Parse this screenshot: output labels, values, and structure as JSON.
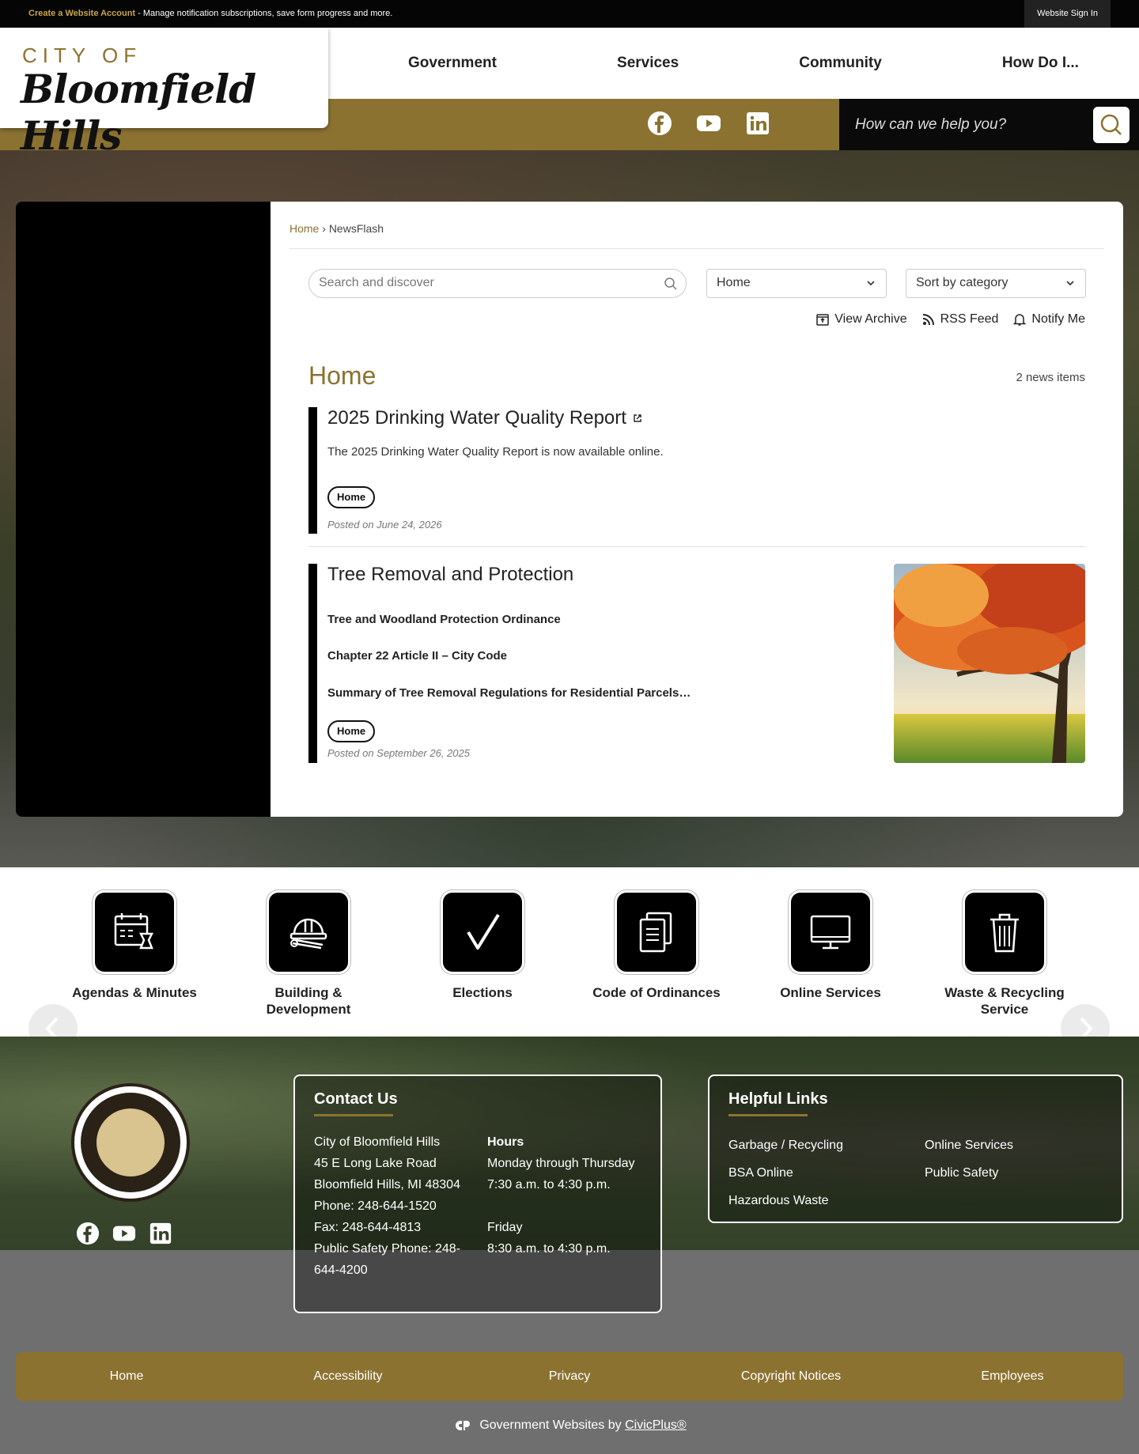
{
  "topbar": {
    "create_link": "Create a Website Account",
    "create_desc": " - Manage notification subscriptions, save form progress and more.",
    "sign_in": "Website Sign In"
  },
  "header": {
    "logo_top": "CITY OF",
    "logo_name": "Bloomfield Hills",
    "nav": [
      "Government",
      "Services",
      "Community",
      "How Do I..."
    ],
    "search_placeholder": "How can we help you?",
    "social": [
      "facebook-icon",
      "youtube-icon",
      "linkedin-icon"
    ]
  },
  "breadcrumb": {
    "home": "Home",
    "sep": " › ",
    "current": "NewsFlash"
  },
  "filters": {
    "search_placeholder": "Search and discover",
    "category_selected": "Home",
    "sort_selected": "Sort by category"
  },
  "tools": {
    "archive": "View Archive",
    "rss": "RSS Feed",
    "notify": "Notify Me"
  },
  "section": {
    "title": "Home",
    "count": "2 news items"
  },
  "items": [
    {
      "title": "2025 Drinking Water Quality Report",
      "desc": "The 2025 Drinking Water Quality Report is now available online.",
      "tag": "Home",
      "posted": "Posted on June 24, 2026"
    },
    {
      "title": "Tree Removal and Protection",
      "line1": "Tree and Woodland Protection Ordinance",
      "line2": "Chapter 22 Article II – City Code",
      "line3": " Summary of Tree Removal Regulations for Residential Parcels…",
      "tag": "Home",
      "posted": "Posted on September 26, 2025"
    }
  ],
  "quick_links": [
    {
      "label": "Agendas & Minutes",
      "icon": "calendar-gavel-icon"
    },
    {
      "label": "Building & Development",
      "icon": "hardhat-icon"
    },
    {
      "label": "Elections",
      "icon": "checkmark-icon"
    },
    {
      "label": "Code of Ordinances",
      "icon": "documents-icon"
    },
    {
      "label": "Online Services",
      "icon": "monitor-icon"
    },
    {
      "label": "Waste & Recycling Service",
      "icon": "trash-icon"
    }
  ],
  "contact": {
    "title": "Contact Us",
    "lines": [
      "City of Bloomfield Hills",
      "45 E Long Lake Road",
      "Bloomfield Hills, MI 48304",
      "Phone: 248-644-1520",
      "Fax: 248-644-4813",
      "Public Safety Phone: 248-644-4200"
    ],
    "hours_title": "Hours",
    "hours_lines": [
      "Monday through Thursday",
      "7:30 a.m. to 4:30 p.m.",
      "",
      "Friday",
      "8:30 a.m. to 4:30 p.m."
    ]
  },
  "helpful": {
    "title": "Helpful Links",
    "col1": [
      "Garbage / Recycling",
      "BSA Online",
      "Hazardous Waste"
    ],
    "col2": [
      "Online Services",
      "Public Safety"
    ]
  },
  "footer_nav": [
    "Home",
    "Accessibility",
    "Privacy",
    "Copyright Notices",
    "Employees"
  ],
  "civic": {
    "prefix": "Government Websites by ",
    "link": "CivicPlus®"
  },
  "colors": {
    "gold": "#8c7231",
    "black": "#000000"
  }
}
